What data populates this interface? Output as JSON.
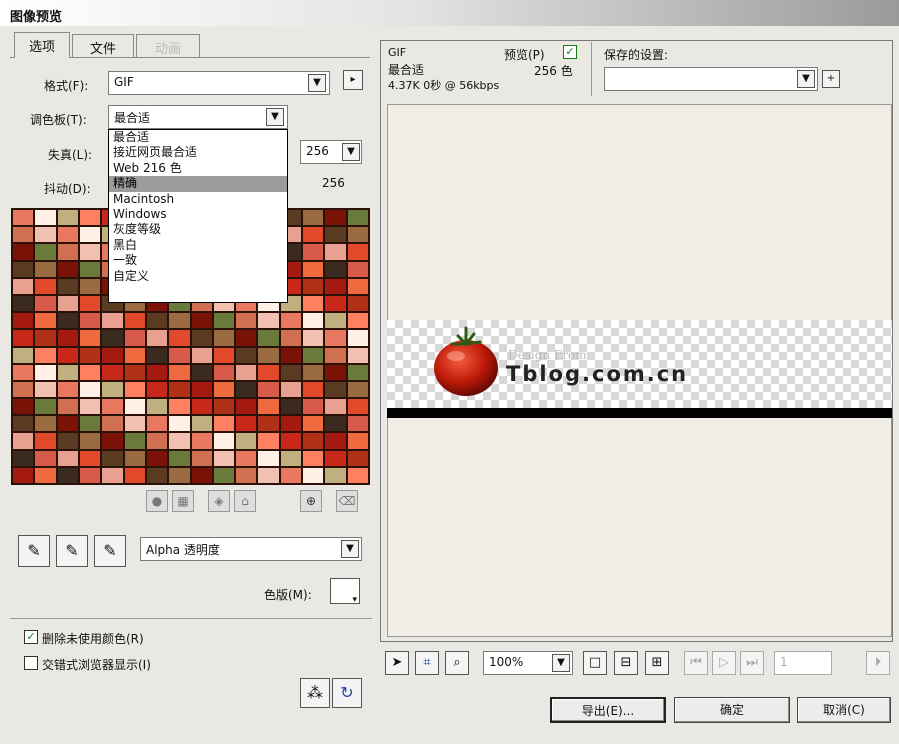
{
  "window": {
    "title": "图像预览"
  },
  "tabs": [
    {
      "label": "选项"
    },
    {
      "label": "文件"
    },
    {
      "label": "动画"
    }
  ],
  "options": {
    "format_label": "格式(F):",
    "format_value": "GIF",
    "palette_label": "调色板(T):",
    "palette_value": "最合适",
    "loss_label": "失真(L):",
    "colors_value": "256",
    "dither_label": "抖动(D):",
    "colors_count": "256"
  },
  "palette_menu": {
    "items": [
      "最合适",
      "接近网页最合适",
      "Web 216 色",
      "精确",
      "Macintosh",
      "Windows",
      "灰度等级",
      "黑白",
      "一致",
      "自定义"
    ],
    "selected_index": 3
  },
  "transparency": {
    "value": "Alpha 透明度",
    "matte_label": "色版(M):"
  },
  "checkboxes": [
    {
      "label": "删除未使用颜色(R)",
      "checked": true
    },
    {
      "label": "交错式浏览器显示(I)",
      "checked": false
    }
  ],
  "preview_info": {
    "format": "GIF",
    "palette": "最合适",
    "size_info": "4.37K 0秒 @ 56kbps",
    "preview_label": "预览(P)",
    "preview_checked": true,
    "colors": "256 色",
    "saved_settings_label": "保存的设置:",
    "saved_settings_value": ""
  },
  "image": {
    "line1": "Design From",
    "line2": "Tblog.com.cn"
  },
  "toolbar": {
    "zoom": "100%",
    "frame": "1"
  },
  "buttons": {
    "export": "导出(E)...",
    "ok": "确定",
    "cancel": "取消(C)"
  },
  "colors": {
    "accent_check": "#1a7a1a",
    "preview_bg": "#f0eee4"
  },
  "icons": {
    "format_options": "arrow-right-icon",
    "saved_add": "plus-icon",
    "eyedroppers": [
      "eyedropper-add-icon",
      "eyedropper-remove-icon",
      "eyedropper-select-icon"
    ],
    "palette_tools": [
      "circle-icon",
      "checker-icon",
      "cube-icon",
      "lock-icon",
      "add-color-icon",
      "trash-icon"
    ],
    "view_tools": [
      "pointer-icon",
      "crop-icon",
      "zoom-icon"
    ]
  }
}
